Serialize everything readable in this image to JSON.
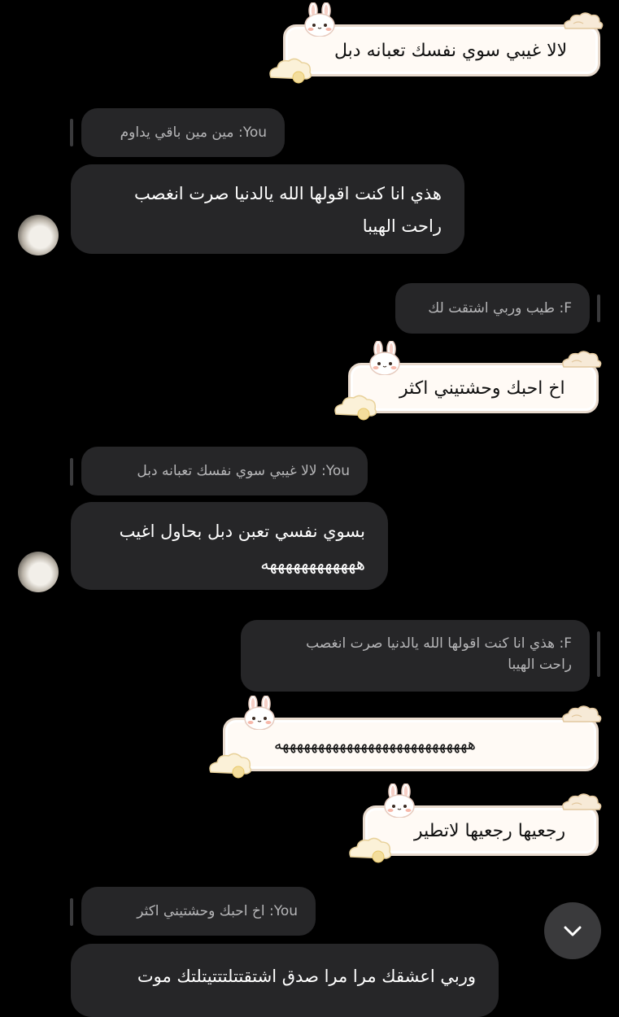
{
  "messages": {
    "m1": {
      "text": "لالا غيبي سوي نفسك تعبانه دبل"
    },
    "r1": {
      "text": "You: مين مين باقي يداوم"
    },
    "m2": {
      "line1": "هذي انا كنت اقولها الله يالدنيا صرت انغصب",
      "line2": "راحت الهيبا"
    },
    "r2": {
      "text": "F: طيب وربي اشتقت لك"
    },
    "m3": {
      "text": "اخ احبك وحشتيني اكثر"
    },
    "r3": {
      "text": "You: لالا غيبي سوي نفسك تعبانه دبل"
    },
    "m4": {
      "line1": "بسوي نفسي تعبن دبل بحاول اغيب",
      "line2": "ههههههههههههه"
    },
    "r4": {
      "line1": "F: هذي انا كنت اقولها الله يالدنيا صرت انغصب",
      "line2": "راحت الهيبا"
    },
    "m5": {
      "text": "هههههههههههههههههههههههههههه"
    },
    "m6": {
      "text": "رجعيها رجعيها لاتطير"
    },
    "r5": {
      "text": "You: اخ احبك وحشتيني اكثر"
    },
    "m7": {
      "text": "وربي اعشقك مرا مرا صدق اشتقتتلتتتيتلتك موت"
    }
  },
  "icons": {
    "scroll_down": "chevron-down-icon",
    "bunny": "bunny-icon",
    "cloud": "cloud-icon"
  },
  "colors": {
    "background": "#000000",
    "received_bubble": "#262628",
    "sticker_bubble": "#fffaf5",
    "sticker_border": "#eadccf"
  }
}
